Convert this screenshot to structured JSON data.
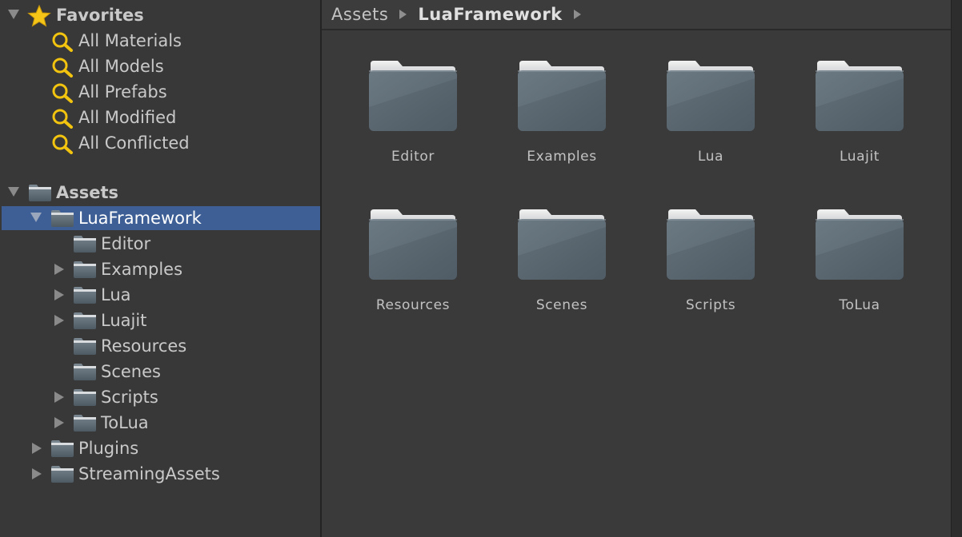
{
  "favorites": {
    "title": "Favorites",
    "items": [
      "All Materials",
      "All Models",
      "All Prefabs",
      "All Modified",
      "All Conflicted"
    ]
  },
  "assets": {
    "title": "Assets",
    "selected_folder": "LuaFramework",
    "children": [
      "Editor",
      "Examples",
      "Lua",
      "Luajit",
      "Resources",
      "Scenes",
      "Scripts",
      "ToLua"
    ],
    "siblings": [
      "Plugins",
      "StreamingAssets"
    ]
  },
  "breadcrumb": [
    "Assets",
    "LuaFramework"
  ],
  "grid": {
    "items": [
      "Editor",
      "Examples",
      "Lua",
      "Luajit",
      "Resources",
      "Scenes",
      "Scripts",
      "ToLua"
    ]
  },
  "colors": {
    "selection": "#3e5f96",
    "search_icon": "#f2c40f",
    "star_icon": "#f5c518",
    "folder": "#5f6d78"
  },
  "icons": {
    "favorites": "star-icon",
    "saved_search": "search-icon",
    "folder": "folder-icon",
    "expand": "triangle-down-icon",
    "collapse": "triangle-right-icon"
  }
}
